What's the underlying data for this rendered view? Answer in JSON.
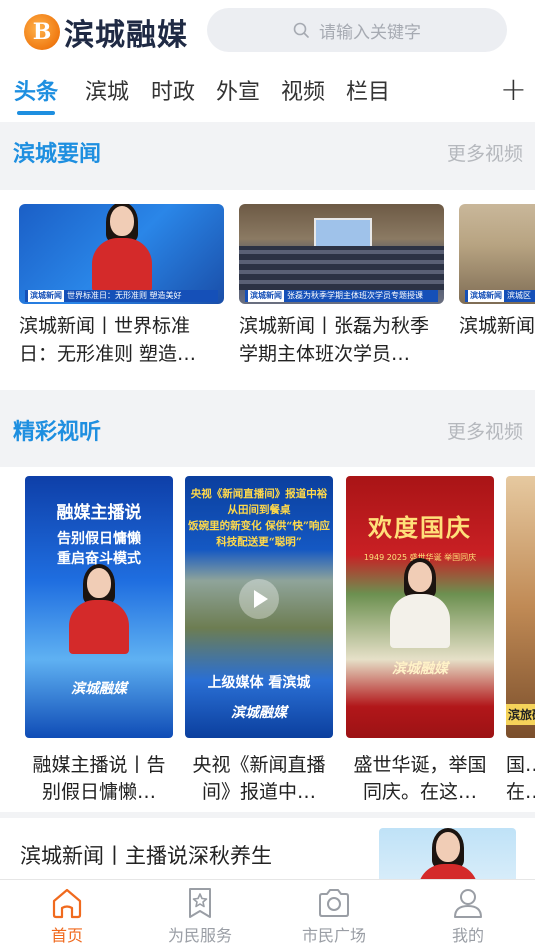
{
  "app": {
    "logo_letter": "B",
    "logo_text": "滨城融媒"
  },
  "search": {
    "placeholder": "请输入关键字"
  },
  "tabs": [
    {
      "label": "头条",
      "active": true
    },
    {
      "label": "滨城",
      "active": false
    },
    {
      "label": "时政",
      "active": false
    },
    {
      "label": "外宣",
      "active": false
    },
    {
      "label": "视频",
      "active": false
    },
    {
      "label": "栏目",
      "active": false
    }
  ],
  "tab_add_label": "+",
  "sections": {
    "news": {
      "title": "滨城要闻",
      "more": "更多视频"
    },
    "video": {
      "title": "精彩视听",
      "more": "更多视频"
    }
  },
  "news_cards": [
    {
      "title": "滨城新闻丨世界标准日：无形准则 塑造…",
      "thumb_tag": "滨城新闻",
      "thumb_caption": "世界标准日：无形准则 塑造美好"
    },
    {
      "title": "滨城新闻丨张磊为秋季学期主体班次学员…",
      "thumb_tag": "滨城新闻",
      "thumb_caption": "张磊为秋季学期主体班次学员专题授课"
    },
    {
      "title": "滨城新闻丨“秋”农业…",
      "thumb_tag": "滨城新闻",
      "thumb_caption": "滨城区"
    }
  ],
  "video_cards": [
    {
      "title": "融媒主播说丨告别假日慵懒…",
      "thumb_title": "融媒主播说",
      "thumb_line1": "告别假日慵懒",
      "thumb_line2": "重启奋斗模式",
      "thumb_brand": "滨城融媒"
    },
    {
      "title": "央视《新闻直播间》报道中…",
      "thumb_line1": "央视《新闻直播间》报道中裕",
      "thumb_line2": "从田间到餐桌",
      "thumb_line3": "饭碗里的新变化 保供“快”响应",
      "thumb_line4": "科技配送更“聪明”",
      "thumb_line5": "上级媒体 看滨城",
      "thumb_brand": "滨城融媒"
    },
    {
      "title": "盛世华诞，举国同庆。在这…",
      "thumb_title": "欢度国庆",
      "thumb_sub": "1949 2025  盛世华诞  举国同庆",
      "thumb_brand": "滨城融媒"
    },
    {
      "title": "国…在…",
      "thumb_caption": "滨旅研"
    }
  ],
  "article": {
    "title": "滨城新闻丨主播说深秋养生"
  },
  "bottom_nav": [
    {
      "label": "首页",
      "icon": "home-icon",
      "active": true
    },
    {
      "label": "为民服务",
      "icon": "bookmark-star-icon",
      "active": false
    },
    {
      "label": "市民广场",
      "icon": "camera-icon",
      "active": false
    },
    {
      "label": "我的",
      "icon": "user-icon",
      "active": false
    }
  ],
  "colors": {
    "accent": "#1e8fe0",
    "nav_active": "#f06a1e",
    "muted": "#b5b8bd"
  }
}
